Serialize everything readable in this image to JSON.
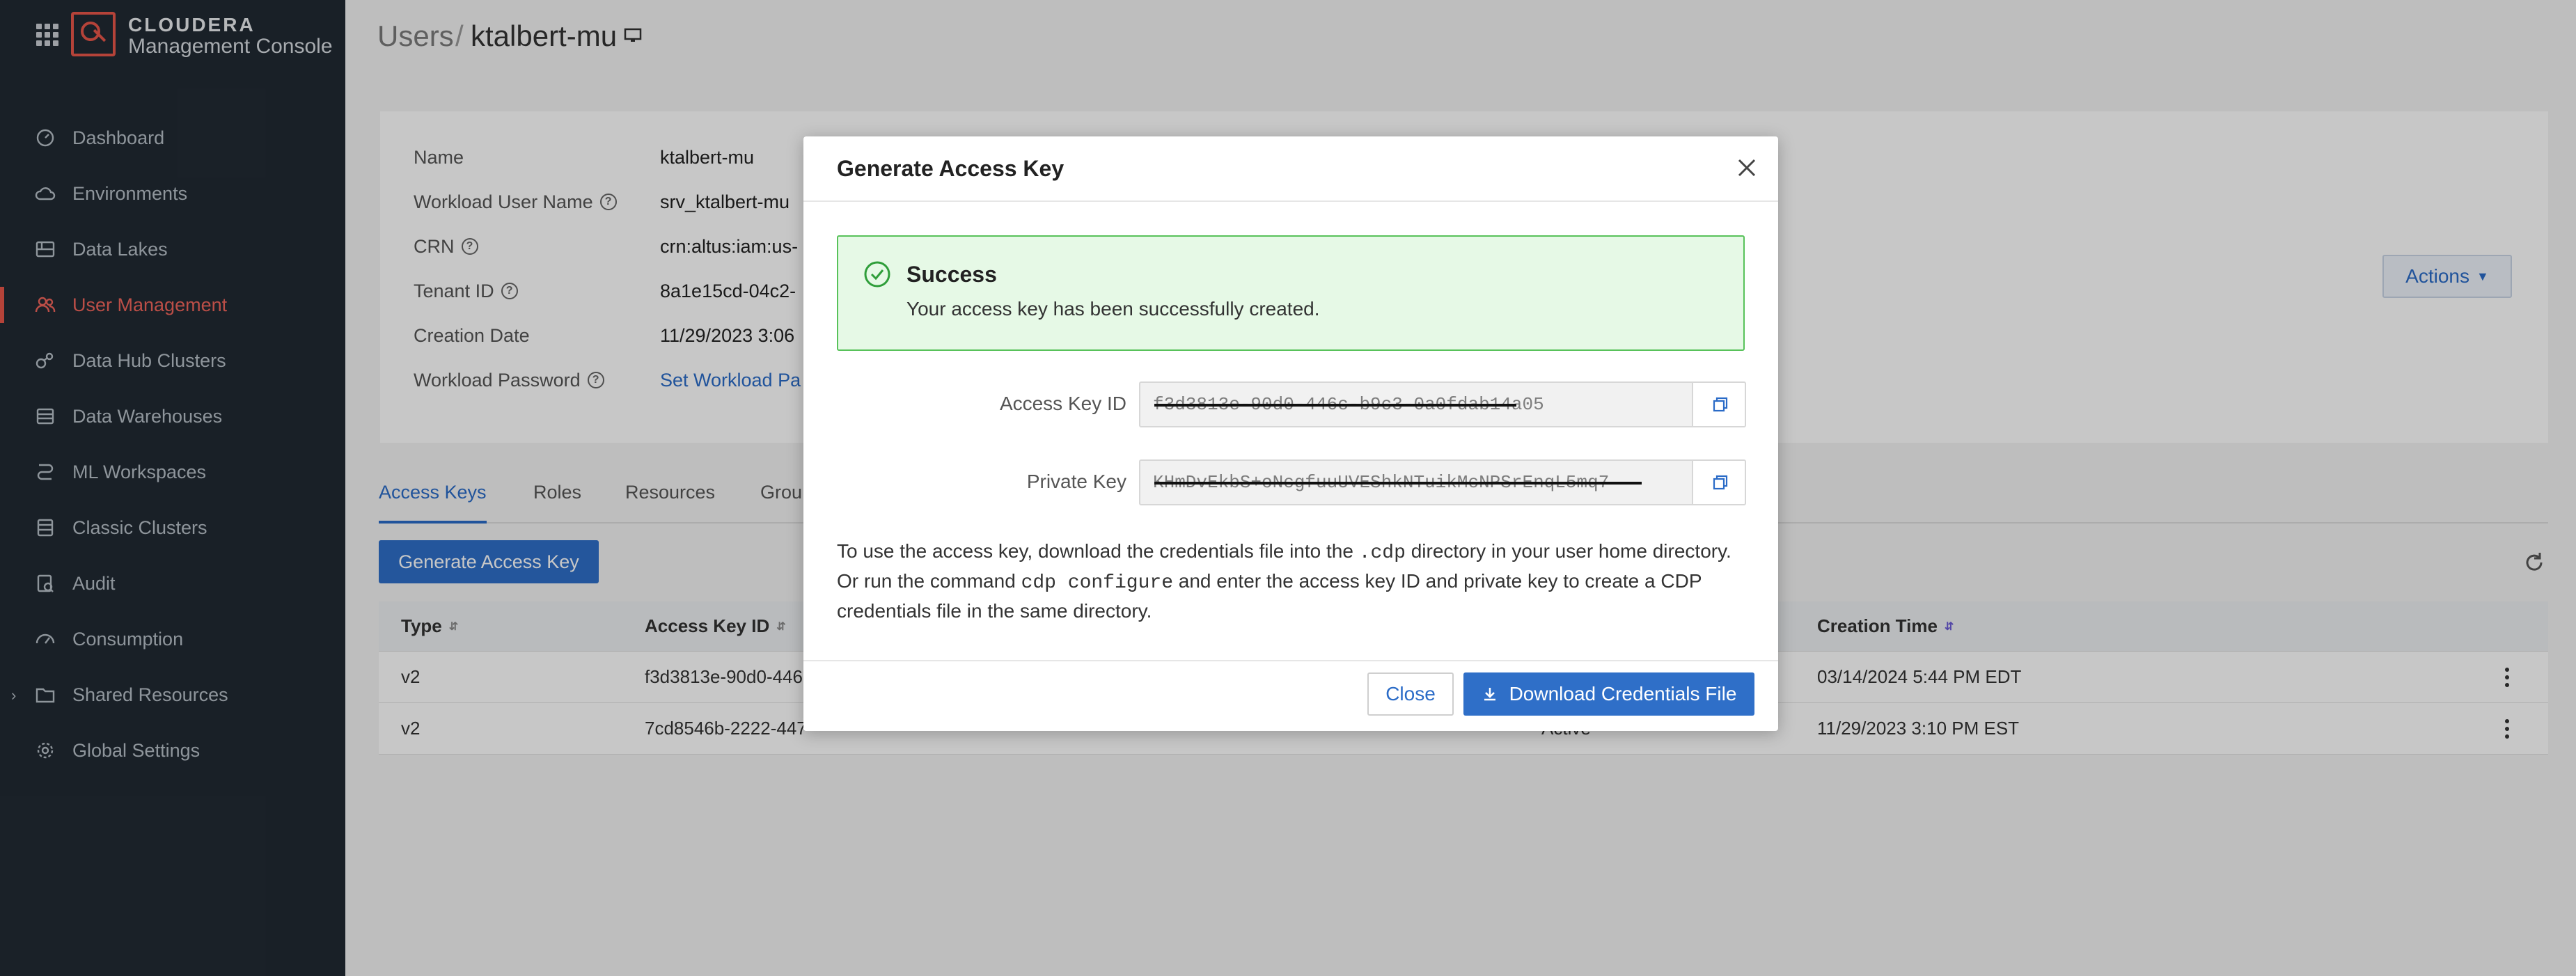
{
  "app": {
    "brand_name": "CLOUDERA",
    "brand_sub": "Management Console"
  },
  "sidebar": {
    "items": [
      {
        "label": "Dashboard",
        "icon": "gauge-icon"
      },
      {
        "label": "Environments",
        "icon": "cloud-icon"
      },
      {
        "label": "Data Lakes",
        "icon": "data-lake-icon"
      },
      {
        "label": "User Management",
        "icon": "users-icon",
        "active": true
      },
      {
        "label": "Data Hub Clusters",
        "icon": "data-hub-icon"
      },
      {
        "label": "Data Warehouses",
        "icon": "warehouse-icon"
      },
      {
        "label": "ML Workspaces",
        "icon": "ml-icon"
      },
      {
        "label": "Classic Clusters",
        "icon": "server-icon"
      },
      {
        "label": "Audit",
        "icon": "audit-icon"
      },
      {
        "label": "Consumption",
        "icon": "consumption-icon"
      },
      {
        "label": "Shared Resources",
        "icon": "folder-icon"
      },
      {
        "label": "Global Settings",
        "icon": "gear-icon"
      }
    ]
  },
  "header": {
    "crumb_parent": "Users",
    "crumb_sep": "/",
    "crumb_current": "ktalbert-mu"
  },
  "details": {
    "name_label": "Name",
    "name_value": "ktalbert-mu",
    "workload_user_label": "Workload User Name",
    "workload_user_value": "srv_ktalbert-mu",
    "crn_label": "CRN",
    "crn_value": "crn:altus:iam:us-",
    "tenant_label": "Tenant ID",
    "tenant_value": "8a1e15cd-04c2-",
    "creation_label": "Creation Date",
    "creation_value": "11/29/2023 3:06",
    "password_label": "Workload Password",
    "password_value": "Set Workload Pa",
    "actions_label": "Actions"
  },
  "tabs": [
    {
      "label": "Access Keys",
      "active": true
    },
    {
      "label": "Roles"
    },
    {
      "label": "Resources"
    },
    {
      "label": "Grou"
    }
  ],
  "generate_button": "Generate Access Key",
  "table": {
    "headers": {
      "type": "Type",
      "access_key_id": "Access Key ID",
      "creation_time": "Creation Time"
    },
    "rows": [
      {
        "type": "v2",
        "key": "f3d3813e-90d0-446",
        "status": "",
        "created": "03/14/2024 5:44 PM EDT"
      },
      {
        "type": "v2",
        "key": "7cd8546b-2222-447",
        "status": "Active",
        "created": "11/29/2023 3:10 PM EST"
      }
    ]
  },
  "modal": {
    "title": "Generate Access Key",
    "success_title": "Success",
    "success_text": "Your access key has been successfully created.",
    "access_key_label": "Access Key ID",
    "access_key_value": "f3d3813e-90d0-446c-b9c3-0a0fdab14a05",
    "private_key_label": "Private Key",
    "private_key_value": "KHmDvEkbS+oNcgfuuUVEShkNTuikMcNPSrEnqL5mq7",
    "instr_1": "To use the access key, download the credentials file into the",
    "instr_code_1": ".cdp",
    "instr_2": "directory in your user home directory. Or run the command",
    "instr_code_2": "cdp configure",
    "instr_3": "and enter the access key ID and private key to create a CDP credentials file in the same directory.",
    "close_label": "Close",
    "download_label": "Download Credentials File"
  },
  "colors": {
    "accent": "#2f6fc8",
    "active_nav": "#e8564a",
    "success_bg": "#e6f9e6",
    "success_border": "#58c25a"
  }
}
